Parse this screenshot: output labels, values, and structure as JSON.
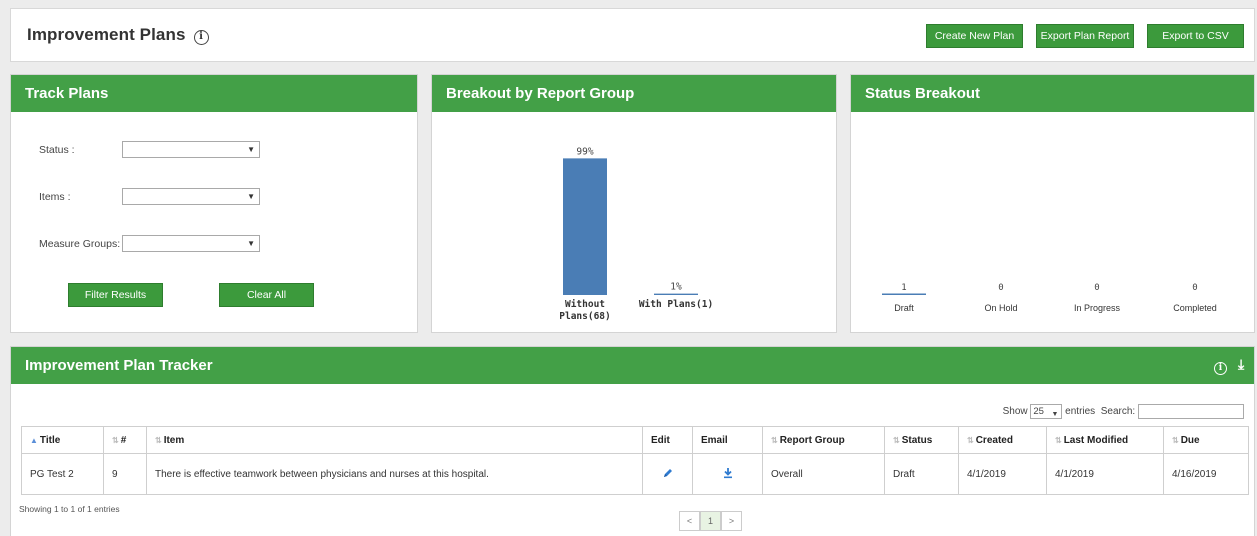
{
  "header": {
    "title": "Improvement Plans",
    "buttons": {
      "create": "Create New Plan",
      "export_report": "Export Plan Report",
      "export_csv": "Export to CSV"
    }
  },
  "track_plans": {
    "title": "Track Plans",
    "filters": [
      {
        "label": "Status :",
        "value": ""
      },
      {
        "label": "Items :",
        "value": ""
      },
      {
        "label": "Measure Groups:",
        "value": ""
      }
    ],
    "filter_button": "Filter Results",
    "clear_button": "Clear All"
  },
  "report_group": {
    "title": "Breakout by Report Group",
    "chart_data": {
      "type": "bar",
      "categories": [
        "Without Plans(68)",
        "With Plans(1)"
      ],
      "category_lines": [
        [
          "Without",
          "Plans(68)"
        ],
        [
          "With Plans(1)"
        ]
      ],
      "values": [
        99,
        1
      ],
      "value_labels": [
        "99%",
        "1%"
      ],
      "ylim": [
        0,
        100
      ],
      "color": "#4a7db5"
    }
  },
  "status_breakout": {
    "title": "Status Breakout",
    "chart_data": {
      "type": "bar",
      "categories": [
        "Draft",
        "On Hold",
        "In Progress",
        "Completed"
      ],
      "values": [
        1,
        0,
        0,
        0
      ],
      "color": "#4a7db5"
    }
  },
  "tracker": {
    "title": "Improvement Plan Tracker",
    "show_label": "Show",
    "entries_value": "25",
    "entries_label": "entries",
    "search_label": "Search:",
    "search_value": "",
    "columns": [
      "Title",
      "#",
      "Item",
      "Edit",
      "Email",
      "Report Group",
      "Status",
      "Created",
      "Last Modified",
      "Due"
    ],
    "rows": [
      {
        "title": "PG Test 2",
        "num": "9",
        "item": "There is effective teamwork between physicians and nurses at this hospital.",
        "report_group": "Overall",
        "status": "Draft",
        "created": "4/1/2019",
        "modified": "4/1/2019",
        "due": "4/16/2019"
      }
    ],
    "showing": "Showing 1 to 1 of 1 entries",
    "pager": {
      "prev": "<",
      "page": "1",
      "next": ">"
    }
  },
  "icons": {
    "info": "info-icon",
    "download": "download-icon",
    "edit": "pencil-icon",
    "email": "download-icon"
  },
  "colors": {
    "green": "#43a047",
    "bar": "#4a7db5"
  }
}
